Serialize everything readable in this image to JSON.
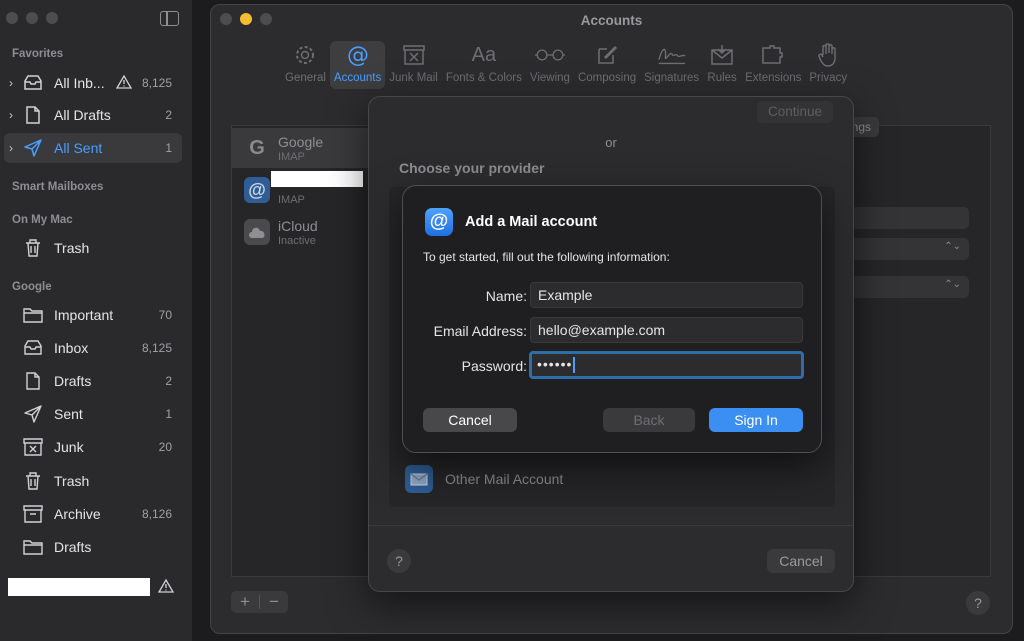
{
  "sidebar": {
    "favorites_label": "Favorites",
    "favorites": [
      {
        "label": "All Inb...",
        "count": "8,125",
        "warning": true
      },
      {
        "label": "All Drafts",
        "count": "2"
      },
      {
        "label": "All Sent",
        "count": "1",
        "selected": true
      }
    ],
    "smart_mailboxes_label": "Smart Mailboxes",
    "on_my_mac_label": "On My Mac",
    "on_my_mac": [
      {
        "label": "Trash"
      }
    ],
    "google_label": "Google",
    "google": [
      {
        "label": "Important",
        "count": "70",
        "icon": "folder-icon"
      },
      {
        "label": "Inbox",
        "count": "8,125",
        "icon": "inbox-icon"
      },
      {
        "label": "Drafts",
        "count": "2",
        "icon": "document-icon"
      },
      {
        "label": "Sent",
        "count": "1",
        "icon": "paperplane-icon"
      },
      {
        "label": "Junk",
        "count": "20",
        "icon": "junk-icon"
      },
      {
        "label": "Trash",
        "count": "",
        "icon": "trash-icon"
      },
      {
        "label": "Archive",
        "count": "8,126",
        "icon": "archive-icon"
      },
      {
        "label": "Drafts",
        "count": "",
        "icon": "folder-icon"
      }
    ]
  },
  "prefs": {
    "title": "Accounts",
    "toolbar": [
      {
        "label": "General",
        "icon": "gear-icon"
      },
      {
        "label": "Accounts",
        "icon": "at-icon",
        "active": true
      },
      {
        "label": "Junk Mail",
        "icon": "junk-icon"
      },
      {
        "label": "Fonts & Colors",
        "icon": "fonts-icon"
      },
      {
        "label": "Viewing",
        "icon": "glasses-icon"
      },
      {
        "label": "Composing",
        "icon": "compose-icon"
      },
      {
        "label": "Signatures",
        "icon": "signature-icon"
      },
      {
        "label": "Rules",
        "icon": "rules-icon"
      },
      {
        "label": "Extensions",
        "icon": "extensions-icon"
      },
      {
        "label": "Privacy",
        "icon": "hand-icon"
      }
    ],
    "accounts": [
      {
        "name": "Google",
        "type": "IMAP"
      },
      {
        "name": "",
        "type": "IMAP"
      },
      {
        "name": "iCloud",
        "type": "Inactive"
      }
    ],
    "tab_fragment": "ings",
    "add_label": "+",
    "remove_label": "−",
    "help_label": "?"
  },
  "sheet": {
    "continue_label": "Continue",
    "or_label": "or",
    "choose_label": "Choose your provider",
    "other_account_label": "Other Mail Account",
    "help_label": "?",
    "cancel_label": "Cancel"
  },
  "dialog": {
    "title": "Add a Mail account",
    "subtitle": "To get started, fill out the following information:",
    "name_label": "Name:",
    "name_value": "Example",
    "email_label": "Email Address:",
    "email_value": "hello@example.com",
    "password_label": "Password:",
    "password_value": "••••••",
    "cancel_label": "Cancel",
    "back_label": "Back",
    "signin_label": "Sign In"
  },
  "colors": {
    "accent": "#4a9eff",
    "primary_button": "#3b8ef2",
    "traffic_yellow": "#f5bd30"
  }
}
